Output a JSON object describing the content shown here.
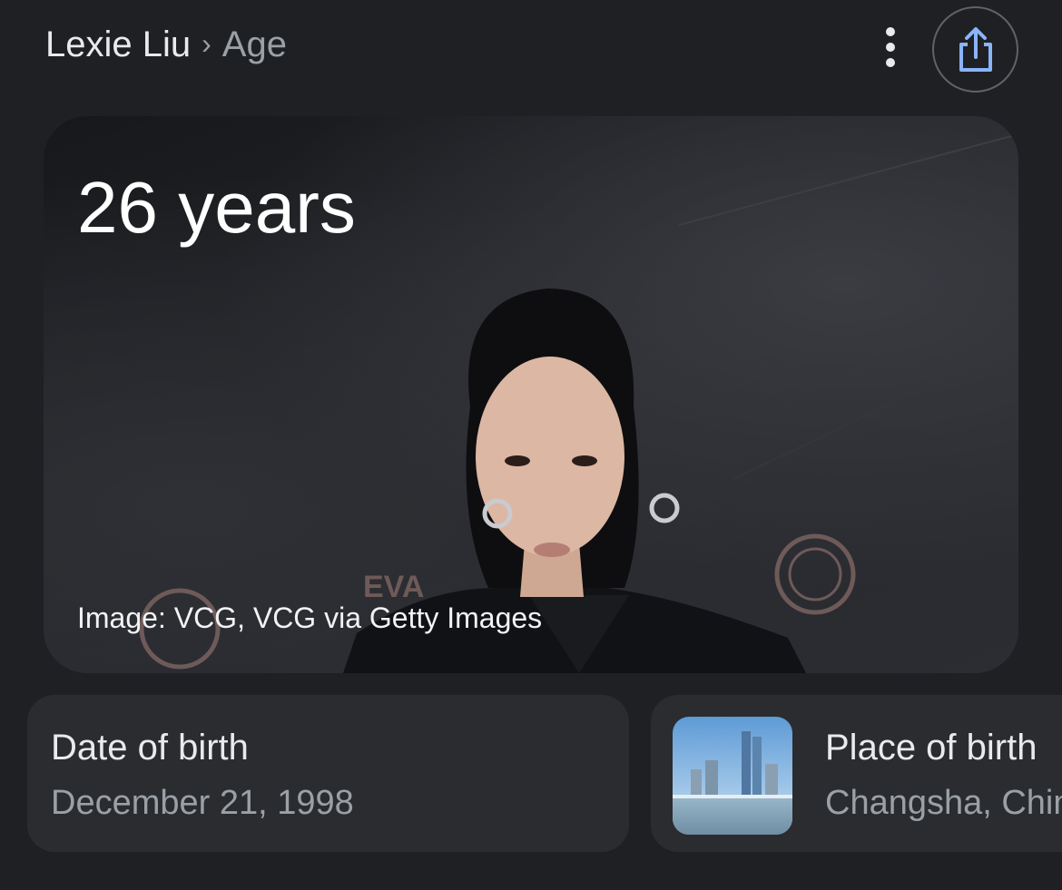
{
  "header": {
    "breadcrumb_root": "Lexie Liu",
    "breadcrumb_separator": "›",
    "breadcrumb_current": "Age",
    "more_icon": "more-vertical-icon",
    "share_icon": "share-icon"
  },
  "hero": {
    "age": "26 years",
    "image_credit": "Image: VCG, VCG via Getty Images"
  },
  "cards": {
    "date_of_birth": {
      "label": "Date of birth",
      "value": "December 21, 1998"
    },
    "place_of_birth": {
      "label": "Place of birth",
      "value": "Changsha, China"
    }
  },
  "colors": {
    "background": "#1f2023",
    "card": "#2a2c30",
    "accent": "#8ab4f8"
  }
}
